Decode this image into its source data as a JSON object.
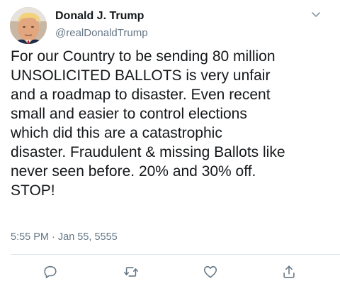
{
  "author": {
    "display_name": "Donald J. Trump",
    "handle": "@realDonaldTrump"
  },
  "tweet": {
    "lines": [
      "For our Country to be sending 80 million",
      "UNSOLICITED BALLOTS is very unfair",
      "and a roadmap to disaster. Even recent",
      "small and easier to control elections",
      "which did this are a catastrophic",
      "disaster. Fraudulent & missing Ballots like",
      "never seen before. 20% and 30% off.",
      "STOP!"
    ],
    "timestamp": "5:55 PM · Jan 55, 5555"
  },
  "icons": {
    "menu": "chevron-down-icon",
    "reply": "reply-icon",
    "retweet": "retweet-icon",
    "like": "heart-icon",
    "share": "share-icon"
  },
  "colors": {
    "text": "#14171a",
    "secondary": "#657786",
    "icon": "#657786",
    "divider": "#e1e8ed"
  }
}
